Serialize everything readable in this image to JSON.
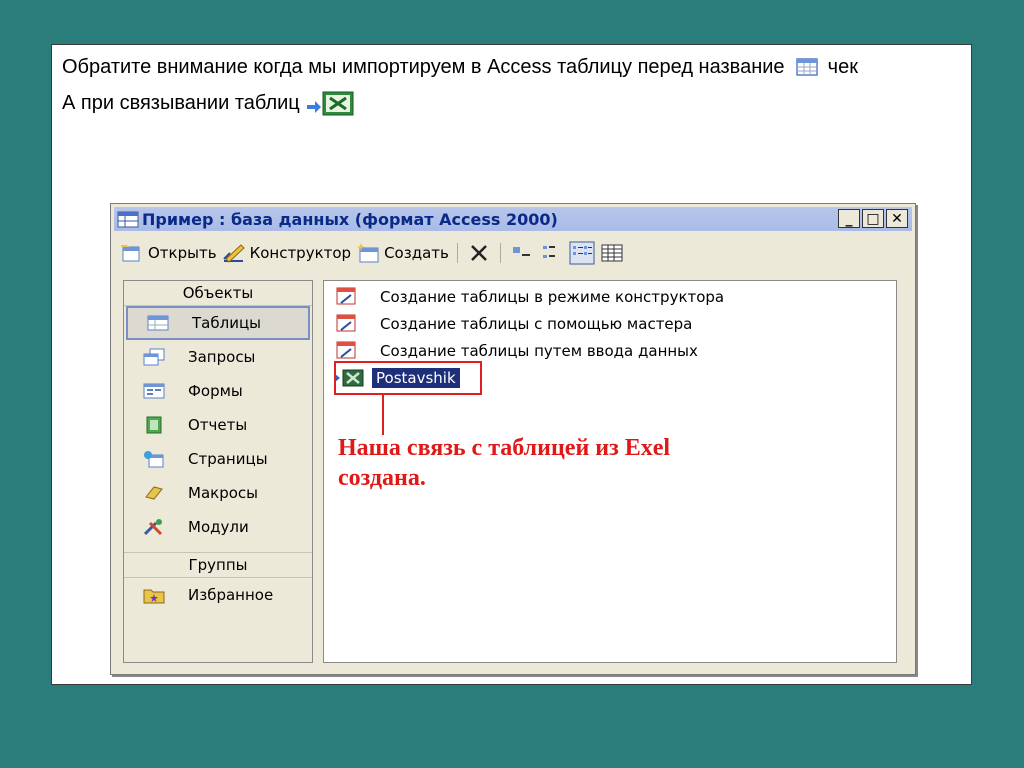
{
  "caption": {
    "line1_text": "Обратите внимание когда мы импортируем в Access таблицу перед название",
    "line1_tail": "чек",
    "line2_text": "А при связывании таблиц"
  },
  "window": {
    "title": "Пример : база данных (формат Access 2000)",
    "toolbar": {
      "open_label": "Открыть",
      "design_label": "Конструктор",
      "create_label": "Создать"
    },
    "objects_header": "Объекты",
    "objects": [
      {
        "label": "Таблицы",
        "icon": "table-icon"
      },
      {
        "label": "Запросы",
        "icon": "query-icon"
      },
      {
        "label": "Формы",
        "icon": "form-icon"
      },
      {
        "label": "Отчеты",
        "icon": "report-icon"
      },
      {
        "label": "Страницы",
        "icon": "page-icon"
      },
      {
        "label": "Макросы",
        "icon": "macro-icon"
      },
      {
        "label": "Модули",
        "icon": "module-icon"
      }
    ],
    "groups_header": "Группы",
    "groups": [
      {
        "label": "Избранное",
        "icon": "favorites-icon"
      }
    ],
    "list": [
      {
        "label": "Создание таблицы в режиме конструктора"
      },
      {
        "label": "Создание таблицы с помощью мастера"
      },
      {
        "label": "Создание таблицы путем ввода данных"
      }
    ],
    "linked_table": "Postavshik",
    "note_line1": "Наша связь с таблицей из Exel",
    "note_line2": "создана."
  },
  "colors": {
    "background": "#2a7d7b",
    "highlight_red": "#e02020",
    "selection_blue": "#1e2f7a"
  }
}
